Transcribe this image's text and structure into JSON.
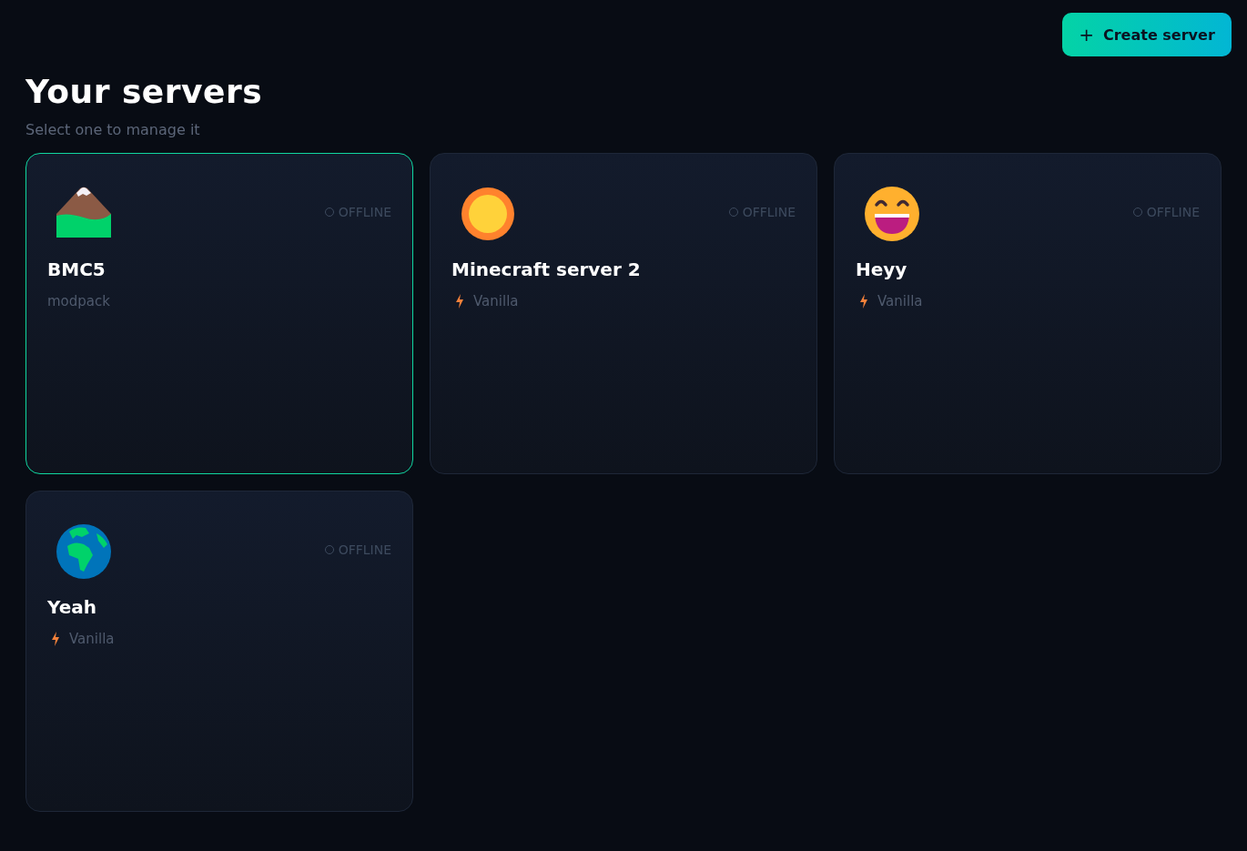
{
  "create_button": {
    "icon": "+",
    "label": "Create server"
  },
  "heading": {
    "title": "Your servers",
    "subtitle": "Select one to manage it"
  },
  "servers": [
    {
      "name": "BMC5",
      "kind": "modpack",
      "type_label": "modpack",
      "status": "OFFLINE",
      "online": false,
      "selected": true
    },
    {
      "name": "Minecraft server 2",
      "kind": "vanilla",
      "type_label": "Vanilla",
      "status": "OFFLINE",
      "online": false,
      "selected": false
    },
    {
      "name": "Heyy",
      "kind": "vanilla",
      "type_label": "Vanilla",
      "status": "OFFLINE",
      "online": false,
      "selected": false
    },
    {
      "name": "Yeah",
      "kind": "vanilla",
      "type_label": "Vanilla",
      "status": "OFFLINE",
      "online": false,
      "selected": false
    }
  ]
}
